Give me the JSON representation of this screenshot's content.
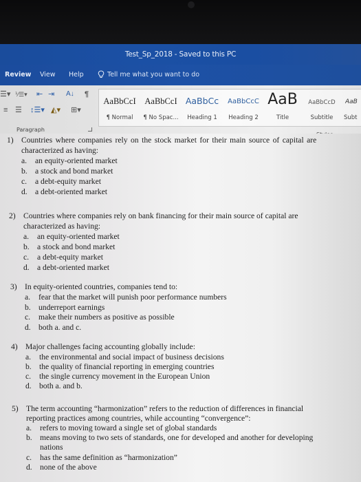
{
  "window": {
    "title": "Test_Sp_2018  -  Saved to this PC"
  },
  "tabs": [
    {
      "label": "Review"
    },
    {
      "label": "View"
    },
    {
      "label": "Help"
    }
  ],
  "tell_me": {
    "icon": "lightbulb-icon",
    "placeholder": "Tell me what you want to do"
  },
  "ribbon": {
    "paragraph_group": {
      "label": "Paragraph",
      "icons_row1": [
        "bullets-icon",
        "numbering-icon",
        "decrease-indent-icon",
        "increase-indent-icon",
        "sort-icon",
        "pilcrow-icon"
      ],
      "icons_row2": [
        "align-right-icon",
        "justify-icon",
        "line-spacing-icon",
        "shading-icon",
        "borders-icon"
      ]
    },
    "styles_group": {
      "label": "Styles",
      "items": [
        {
          "preview": "AaBbCcI",
          "name": "¶ Normal"
        },
        {
          "preview": "AaBbCcI",
          "name": "¶ No Spac..."
        },
        {
          "preview": "AaBbCc",
          "name": "Heading 1"
        },
        {
          "preview": "AaBbCcC",
          "name": "Heading 2"
        },
        {
          "preview": "AaB",
          "name": "Title"
        },
        {
          "preview": "AaBbCcD",
          "name": "Subtitle"
        },
        {
          "preview": "AaB",
          "name": "Subt"
        }
      ]
    }
  },
  "document": {
    "questions": [
      {
        "number": "1)",
        "lines": [
          "Countries where companies rely on the stock market for their main source of capital are",
          "characterized as having:"
        ],
        "options": [
          {
            "letter": "a.",
            "text": "an equity-oriented market"
          },
          {
            "letter": "b.",
            "text": "a stock and bond market"
          },
          {
            "letter": "c.",
            "text": "a debt-equity market"
          },
          {
            "letter": "d.",
            "text": "a debt-oriented market"
          }
        ]
      },
      {
        "number": "2)",
        "lines": [
          "Countries where companies rely on bank financing for their main source of capital are",
          "characterized as having:"
        ],
        "options": [
          {
            "letter": "a.",
            "text": "an equity-oriented market"
          },
          {
            "letter": "b.",
            "text": "a stock and bond market"
          },
          {
            "letter": "c.",
            "text": "a debt-equity market"
          },
          {
            "letter": "d.",
            "text": "a debt-oriented market"
          }
        ]
      },
      {
        "number": "3)",
        "lines": [
          "In equity-oriented countries, companies tend to:"
        ],
        "options": [
          {
            "letter": "a.",
            "text": "fear that the market will punish poor performance numbers"
          },
          {
            "letter": "b.",
            "text": "underreport earnings"
          },
          {
            "letter": "c.",
            "text": "make their numbers as positive as possible"
          },
          {
            "letter": "d.",
            "text": "both a. and c."
          }
        ]
      },
      {
        "number": "4)",
        "lines": [
          "Major challenges facing accounting globally include:"
        ],
        "options": [
          {
            "letter": "a.",
            "text": "the environmental and social impact of business decisions"
          },
          {
            "letter": "b.",
            "text": "the quality of financial reporting in emerging countries"
          },
          {
            "letter": "c.",
            "text": "the single currency movement in the European Union"
          },
          {
            "letter": "d.",
            "text": "both a. and b."
          }
        ]
      },
      {
        "number": "5)",
        "lines": [
          "The term accounting “harmonization” refers to the reduction of differences in financial",
          "reporting practices among countries, while accounting “convergence”:"
        ],
        "options": [
          {
            "letter": "a.",
            "text": "refers to moving toward a single set of global standards"
          },
          {
            "letter": "b.",
            "text": "means moving to two sets of standards, one for developed and another for developing",
            "text2": "nations"
          },
          {
            "letter": "c.",
            "text": "has the same definition as “harmonization”"
          },
          {
            "letter": "d.",
            "text": "none of the above"
          }
        ]
      }
    ]
  },
  "colors": {
    "title_bar": "#1b50a5",
    "ribbon_bg": "#e6e6e6",
    "heading_style_blue": "#2e5f9f"
  }
}
